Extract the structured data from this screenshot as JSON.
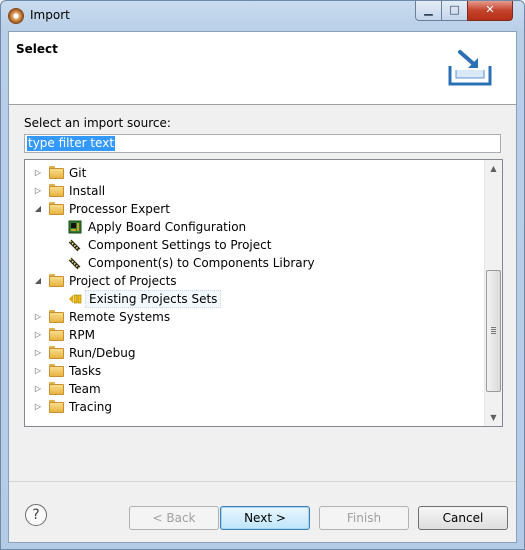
{
  "window": {
    "title": "Import",
    "controls": {
      "minimize": "▁",
      "maximize": "□",
      "close": "✕"
    }
  },
  "header": {
    "title": "Select",
    "icon": "import-banner-icon"
  },
  "filter": {
    "label": "Select an import source:",
    "value": "type filter text"
  },
  "tree": {
    "items": [
      {
        "label": "Git",
        "icon": "folder-icon",
        "expanded": false
      },
      {
        "label": "Install",
        "icon": "folder-icon",
        "expanded": false
      },
      {
        "label": "Processor Expert",
        "icon": "folder-icon",
        "expanded": true
      },
      {
        "label": "Apply Board Configuration",
        "icon": "board-icon"
      },
      {
        "label": "Component Settings to Project",
        "icon": "component-icon"
      },
      {
        "label": "Component(s) to Components Library",
        "icon": "component-icon"
      },
      {
        "label": "Project of Projects",
        "icon": "folder-icon",
        "expanded": true
      },
      {
        "label": "Existing Projects Sets",
        "icon": "project-set-icon",
        "selected": true
      },
      {
        "label": "Remote Systems",
        "icon": "folder-icon",
        "expanded": false
      },
      {
        "label": "RPM",
        "icon": "folder-icon",
        "expanded": false
      },
      {
        "label": "Run/Debug",
        "icon": "folder-icon",
        "expanded": false
      },
      {
        "label": "Tasks",
        "icon": "folder-icon",
        "expanded": false
      },
      {
        "label": "Team",
        "icon": "folder-icon",
        "expanded": false
      },
      {
        "label": "Tracing",
        "icon": "folder-icon",
        "expanded": false
      }
    ]
  },
  "buttons": {
    "help": "?",
    "back": "< Back",
    "next": "Next >",
    "finish": "Finish",
    "cancel": "Cancel"
  }
}
